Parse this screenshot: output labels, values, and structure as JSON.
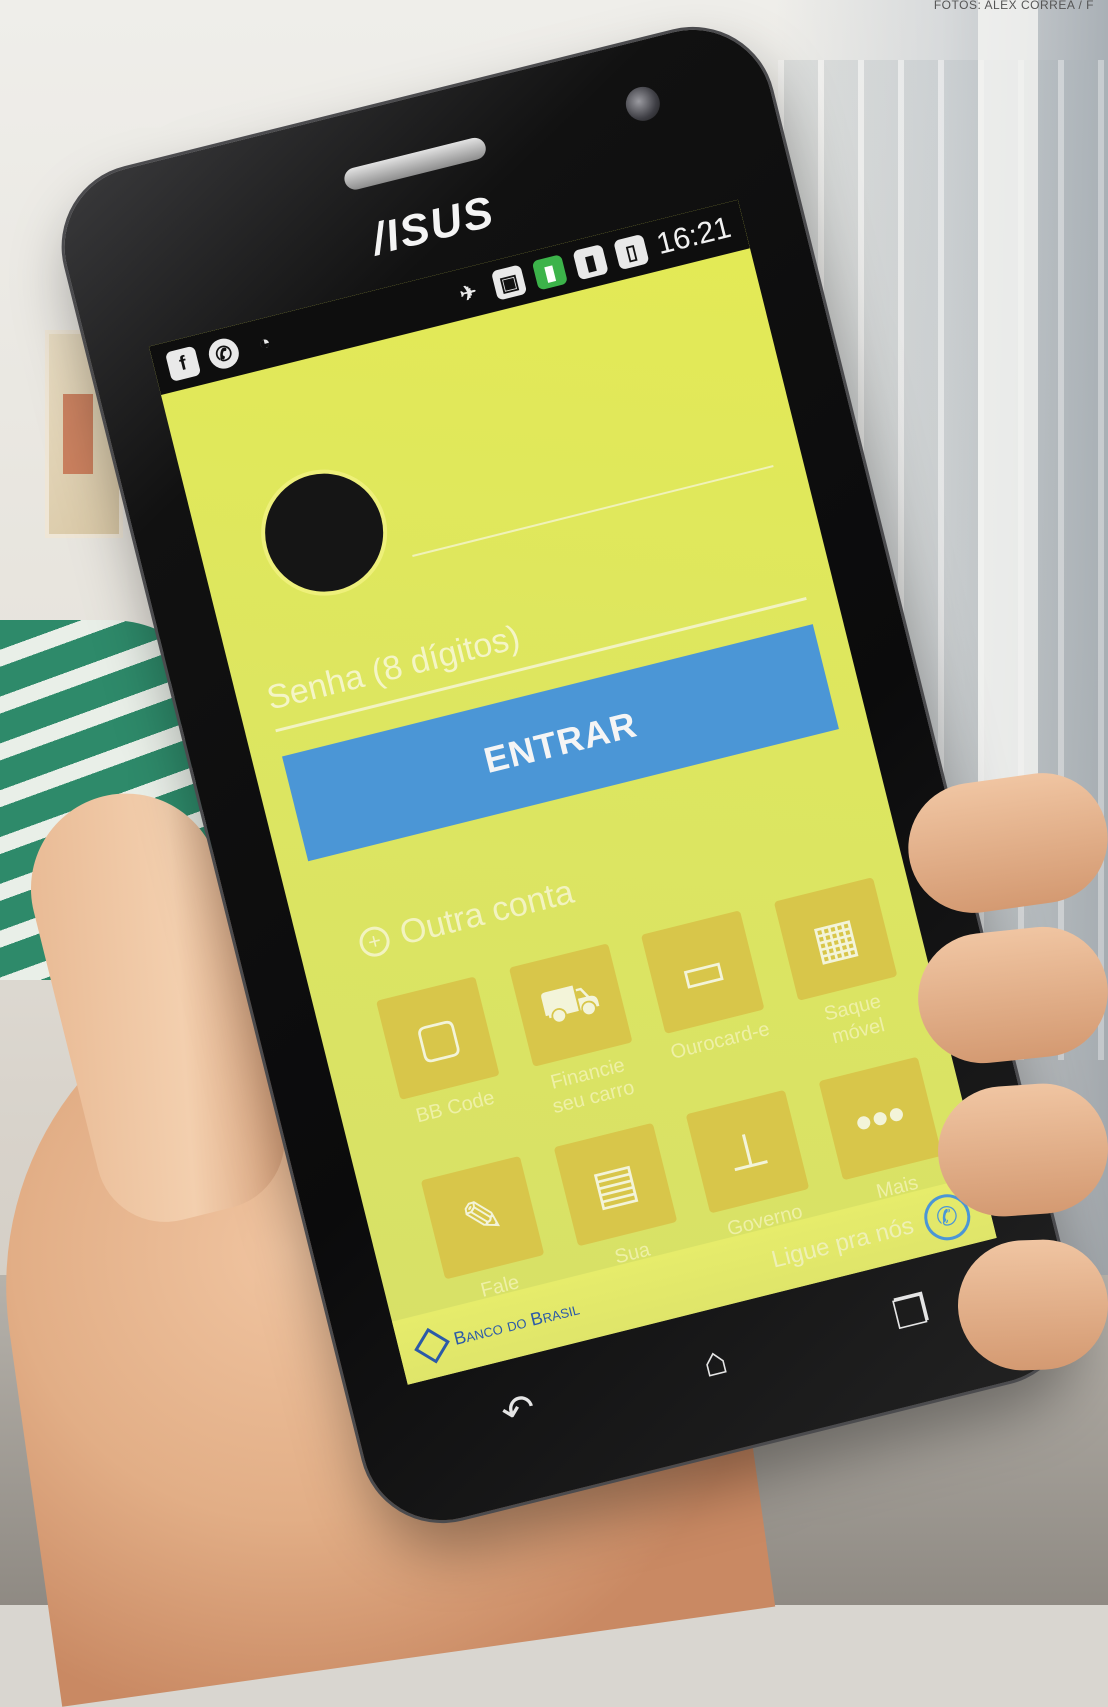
{
  "photo_credit": "FOTOS: ALEX CORREA / F",
  "phone": {
    "brand": "/ISUS",
    "status_bar": {
      "left_icons": [
        "facebook-icon",
        "whatsapp-icon",
        "wifi-icon"
      ],
      "right_icons": [
        "airplane-icon",
        "notification-icon",
        "signal-icon",
        "signal-icon-2",
        "battery-icon"
      ],
      "time": "16:21"
    }
  },
  "login": {
    "password_placeholder": "Senha (8 dígitos)",
    "enter_label": "ENTRAR",
    "other_account": "Outra conta"
  },
  "apps": [
    {
      "label": "BB Code",
      "icon": "lock-icon"
    },
    {
      "label": "Financie\nseu carro",
      "icon": "car-icon"
    },
    {
      "label": "Ourocard-e",
      "icon": "card-icon"
    },
    {
      "label": "Saque\nmóvel",
      "icon": "qr-icon"
    },
    {
      "label": "Fale\nConosco",
      "icon": "pencil-icon"
    },
    {
      "label": "Sua\nempresa",
      "icon": "briefcase-icon"
    },
    {
      "label": "Governo",
      "icon": "government-icon"
    },
    {
      "label": "Mais\nAplicativos",
      "icon": "more-icon"
    }
  ],
  "footer": {
    "brand": "Banco do Brasil",
    "call_label": "Ligue pra nós"
  },
  "colors": {
    "screen_yellow": "#e4ea55",
    "button_blue": "#4b96d6",
    "tile_yellow": "#d8c64a"
  }
}
